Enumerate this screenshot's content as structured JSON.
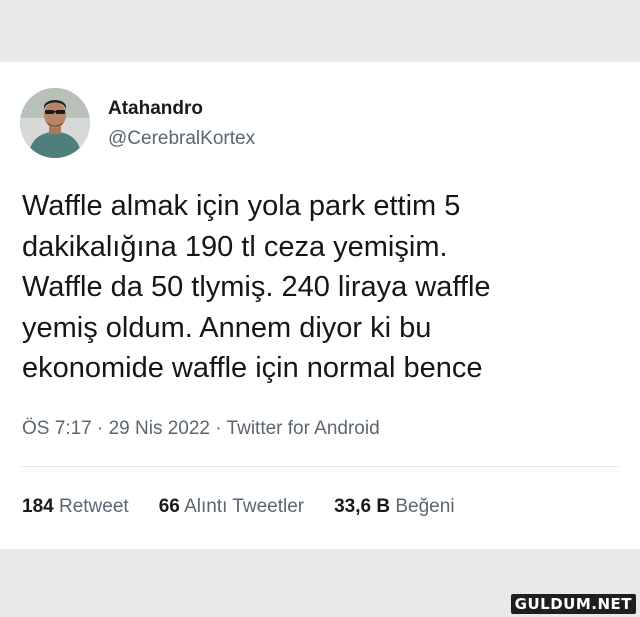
{
  "tweet": {
    "author": {
      "display_name": "Atahandro",
      "handle": "@CerebralKortex"
    },
    "text": "Waffle almak için yola park ettim 5\ndakikalığına 190 tl ceza yemişim.\nWaffle da 50 tlymiş. 240 liraya waffle\nyemiş oldum. Annem diyor ki bu\nekonomide waffle için normal bence",
    "meta": "ÖS 7:17 · 29 Nis 2022 · Twitter for Android",
    "stats": [
      {
        "count": "184",
        "label": "Retweet"
      },
      {
        "count": "66",
        "label": "Alıntı Tweetler"
      },
      {
        "count": "33,6 B",
        "label": "Beğeni"
      }
    ]
  },
  "watermark": "GULDUM.NET"
}
